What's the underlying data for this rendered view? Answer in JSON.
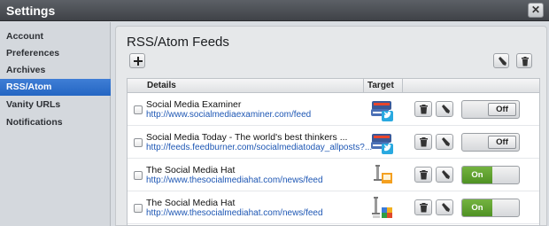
{
  "window": {
    "title": "Settings"
  },
  "sidebar": {
    "items": [
      {
        "label": "Account"
      },
      {
        "label": "Preferences"
      },
      {
        "label": "Archives"
      },
      {
        "label": "RSS/Atom"
      },
      {
        "label": "Vanity URLs"
      },
      {
        "label": "Notifications"
      }
    ],
    "active": "RSS/Atom"
  },
  "main": {
    "title": "RSS/Atom Feeds",
    "columns": {
      "details": "Details",
      "target": "Target"
    },
    "feeds": [
      {
        "name": "Social Media Examiner",
        "url": "http://www.socialmediaexaminer.com/feed",
        "state": "Off",
        "target_icon": "social-network-icon"
      },
      {
        "name": "Social Media Today - The world's best thinkers ...",
        "url": "http://feeds.feedburner.com/socialmediatoday_allposts?...",
        "state": "Off",
        "target_icon": "social-network-icon"
      },
      {
        "name": "The Social Media Hat",
        "url": "http://www.thesocialmediahat.com/news/feed",
        "state": "On",
        "target_icon": "profile-icon"
      },
      {
        "name": "The Social Media Hat",
        "url": "http://www.thesocialmediahat.com/news/feed",
        "state": "On",
        "target_icon": "profile-icon"
      }
    ]
  },
  "colors": {
    "accent": "#2466c3",
    "on": "#5a9c2e",
    "link": "#1e57b4"
  }
}
